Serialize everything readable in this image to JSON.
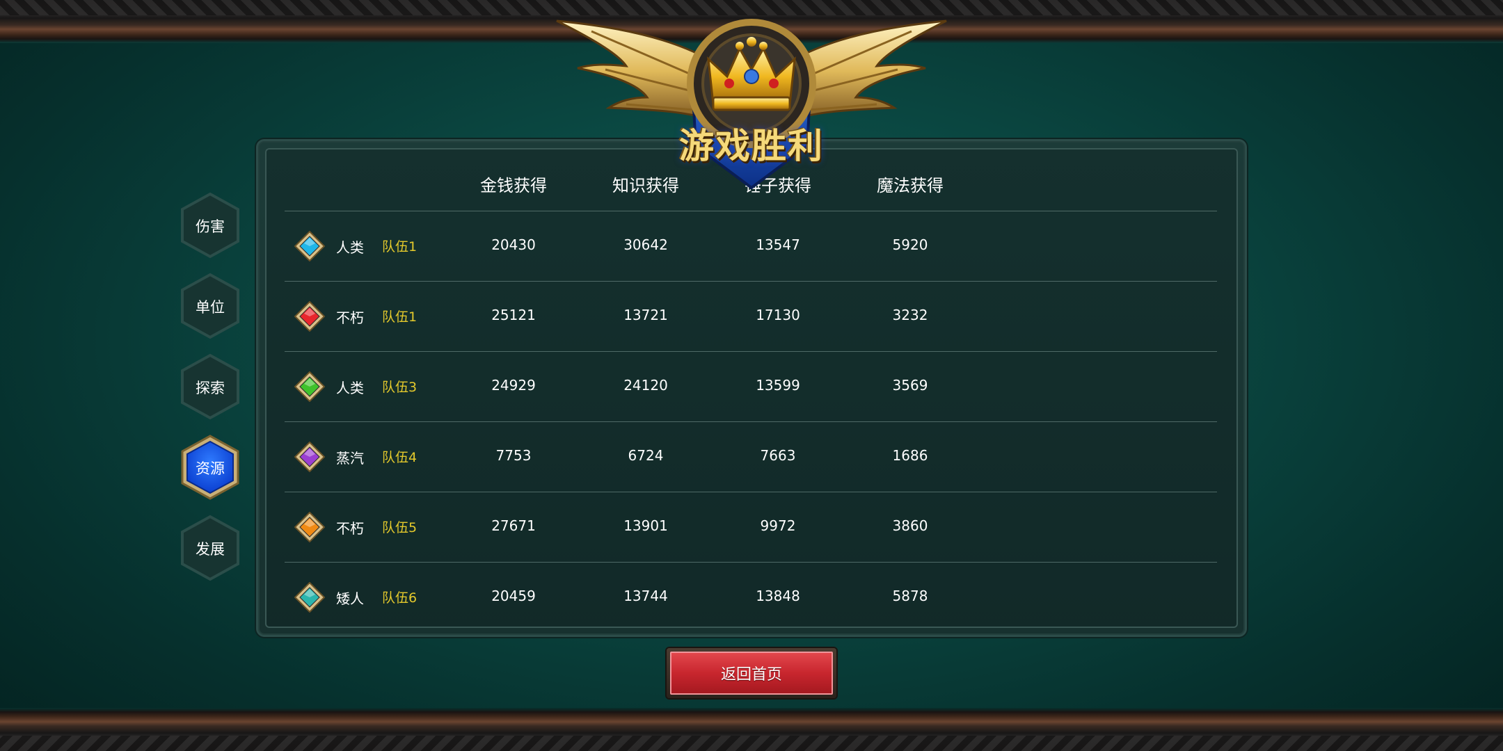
{
  "emblem": {
    "title": "游戏胜利",
    "icon": "crown-winged-shield-icon"
  },
  "columns": [
    "金钱获得",
    "知识获得",
    "锤子获得",
    "魔法获得"
  ],
  "rows": [
    {
      "race": "人类",
      "team": "队伍1",
      "gem_color": "#1fb6e8",
      "values": [
        "20430",
        "30642",
        "13547",
        "5920"
      ]
    },
    {
      "race": "不朽",
      "team": "队伍1",
      "gem_color": "#e8262d",
      "values": [
        "25121",
        "13721",
        "17130",
        "3232"
      ]
    },
    {
      "race": "人类",
      "team": "队伍3",
      "gem_color": "#3fc22c",
      "values": [
        "24929",
        "24120",
        "13599",
        "3569"
      ]
    },
    {
      "race": "蒸汽",
      "team": "队伍4",
      "gem_color": "#9b3fd1",
      "values": [
        "7753",
        "6724",
        "7663",
        "1686"
      ]
    },
    {
      "race": "不朽",
      "team": "队伍5",
      "gem_color": "#f08a14",
      "values": [
        "27671",
        "13901",
        "9972",
        "3860"
      ]
    },
    {
      "race": "矮人",
      "team": "队伍6",
      "gem_color": "#2bb5ad",
      "values": [
        "20459",
        "13744",
        "13848",
        "5878"
      ]
    }
  ],
  "tabs": [
    {
      "label": "伤害",
      "active": false
    },
    {
      "label": "单位",
      "active": false
    },
    {
      "label": "探索",
      "active": false
    },
    {
      "label": "资源",
      "active": true
    },
    {
      "label": "发展",
      "active": false
    }
  ],
  "home_button": {
    "label": "返回首页"
  },
  "colors": {
    "team_text": "#e4c92c",
    "active_tab": "#1a63f2",
    "button_red": "#c8262e"
  }
}
